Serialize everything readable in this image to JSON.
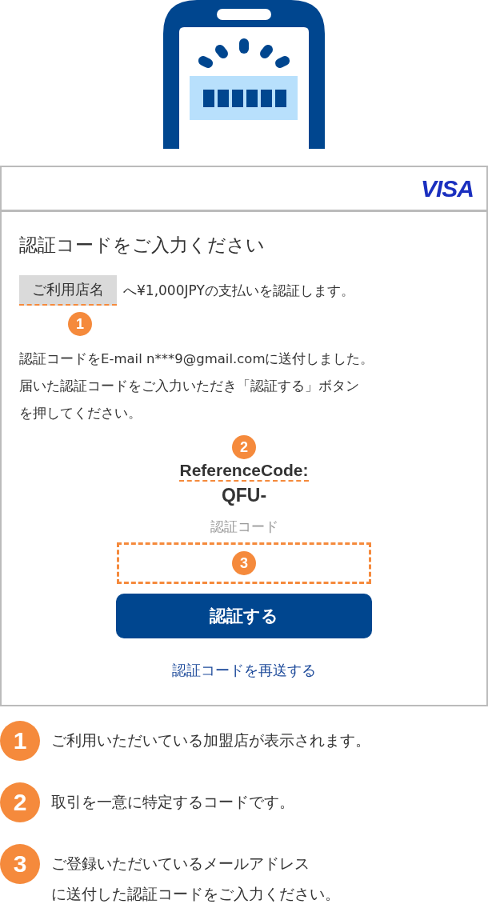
{
  "dialog": {
    "brand": "VISA",
    "title": "認証コードをご入力ください",
    "merchant": {
      "label": "ご利用店名",
      "marker": "1"
    },
    "payment_text": "へ¥1,000JPYの支払いを認証します。",
    "message_lines": [
      "認証コードをE-mail n***9@gmail.comに送付しました。",
      "届いた認証コードをご入力いただき「認証する」ボタン",
      "を押してください。"
    ],
    "reference": {
      "marker": "2",
      "label": "ReferenceCode:",
      "value": "QFU-"
    },
    "code_field": {
      "label": "認証コード",
      "marker": "3"
    },
    "submit_button": "認証する",
    "resend_link": "認証コードを再送する"
  },
  "legend": [
    {
      "number": "1",
      "lines": [
        "ご利用いただいている加盟店が表示されます。"
      ]
    },
    {
      "number": "2",
      "lines": [
        "取引を一意に特定するコードです。"
      ]
    },
    {
      "number": "3",
      "lines": [
        "ご登録いただいているメールアドレス",
        "に送付した認証コードをご入力ください。"
      ]
    }
  ]
}
